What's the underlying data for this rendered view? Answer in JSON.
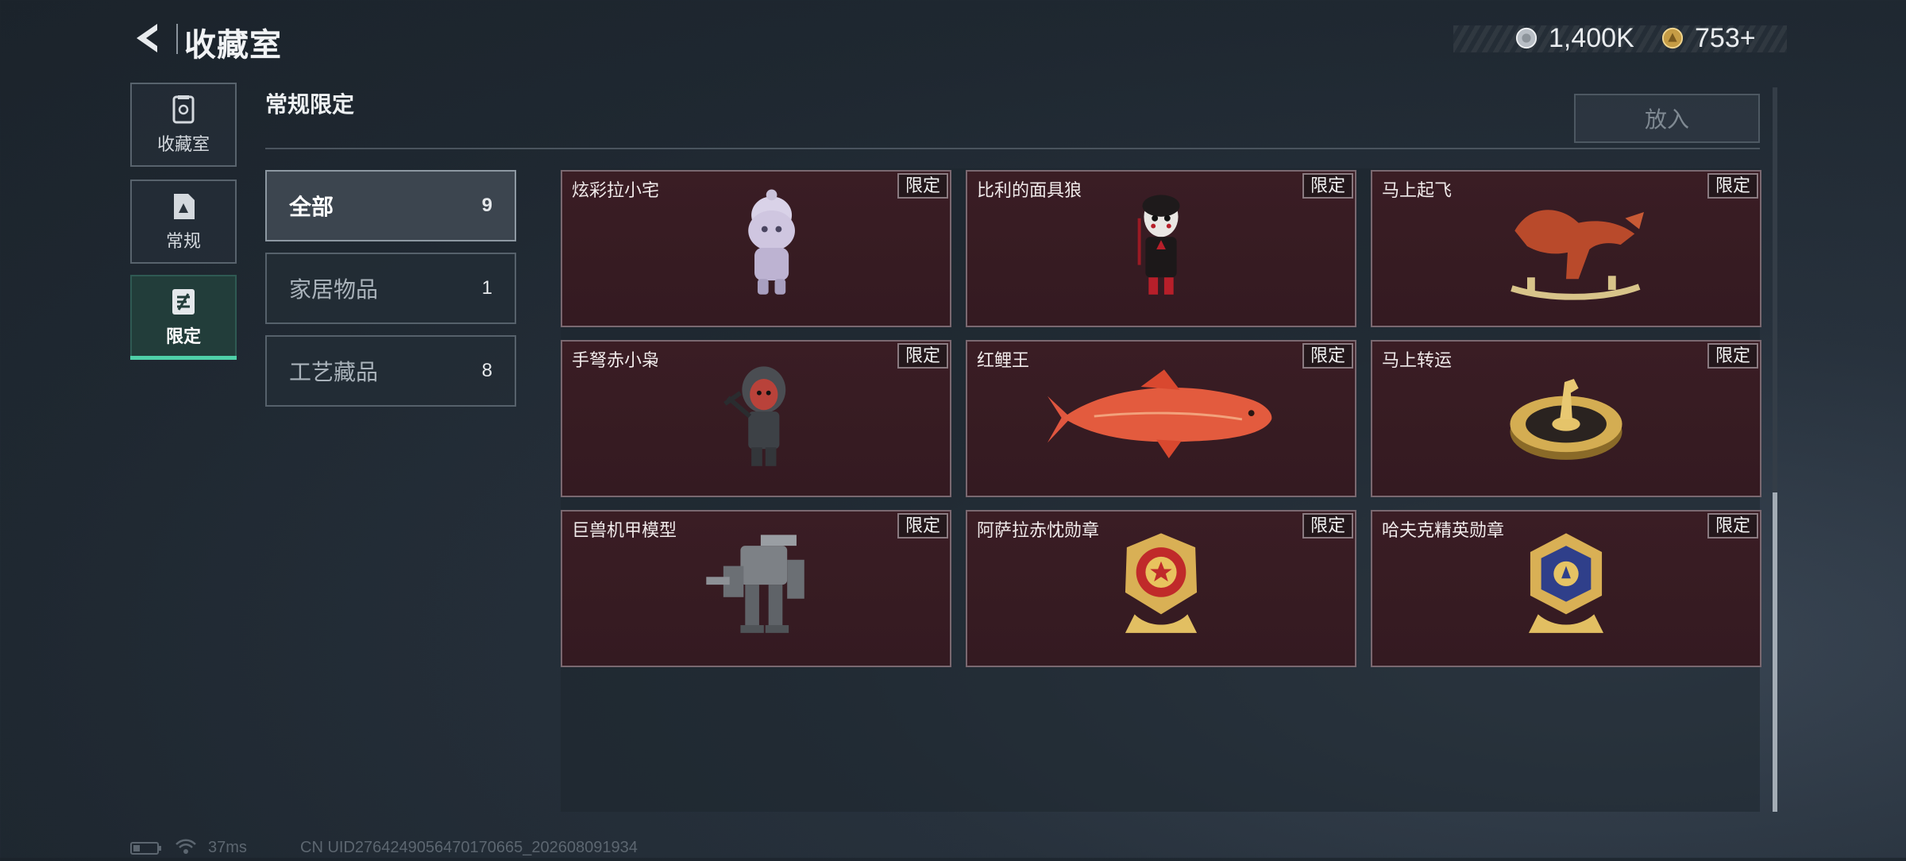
{
  "header": {
    "back_icon": "back-chevron-icon",
    "title": "收藏室",
    "currencies": [
      {
        "icon": "silver-coin-icon",
        "value": "1,400K",
        "color": "#c9cdd2"
      },
      {
        "icon": "gold-coin-icon",
        "value": "753+",
        "color": "#d6b15a"
      }
    ]
  },
  "side_tabs": [
    {
      "label": "收藏室",
      "icon": "collection-room-icon",
      "active": false
    },
    {
      "label": "常规",
      "icon": "regular-doc-icon",
      "active": false
    },
    {
      "label": "限定",
      "icon": "limited-icon",
      "active": true
    }
  ],
  "section": {
    "title": "常规限定",
    "put_button": "放入"
  },
  "categories": [
    {
      "label": "全部",
      "count": "9",
      "active": true
    },
    {
      "label": "家居物品",
      "count": "1",
      "active": false
    },
    {
      "label": "工艺藏品",
      "count": "8",
      "active": false
    }
  ],
  "items": [
    {
      "name": "炫彩拉小宅",
      "badge": "限定",
      "icon": "figurine-doll-icon"
    },
    {
      "name": "比利的面具狼",
      "badge": "限定",
      "icon": "puppet-figure-icon"
    },
    {
      "name": "马上起飞",
      "badge": "限定",
      "icon": "rocking-horse-icon"
    },
    {
      "name": "手弩赤小枭",
      "badge": "限定",
      "icon": "hooded-figure-icon"
    },
    {
      "name": "红鲤王",
      "badge": "限定",
      "icon": "red-carp-icon"
    },
    {
      "name": "马上转运",
      "badge": "限定",
      "icon": "horse-wheel-icon"
    },
    {
      "name": "巨兽机甲模型",
      "badge": "限定",
      "icon": "mech-model-icon"
    },
    {
      "name": "阿萨拉赤忱勋章",
      "badge": "限定",
      "icon": "gold-medal-red-icon"
    },
    {
      "name": "哈夫克精英勋章",
      "badge": "限定",
      "icon": "gold-medal-blue-icon"
    }
  ],
  "status_bar": {
    "battery_icon": "battery-icon",
    "wifi_icon": "wifi-icon",
    "ping": "37ms",
    "uid": "CN UID2764249056470170665_202608091934"
  }
}
